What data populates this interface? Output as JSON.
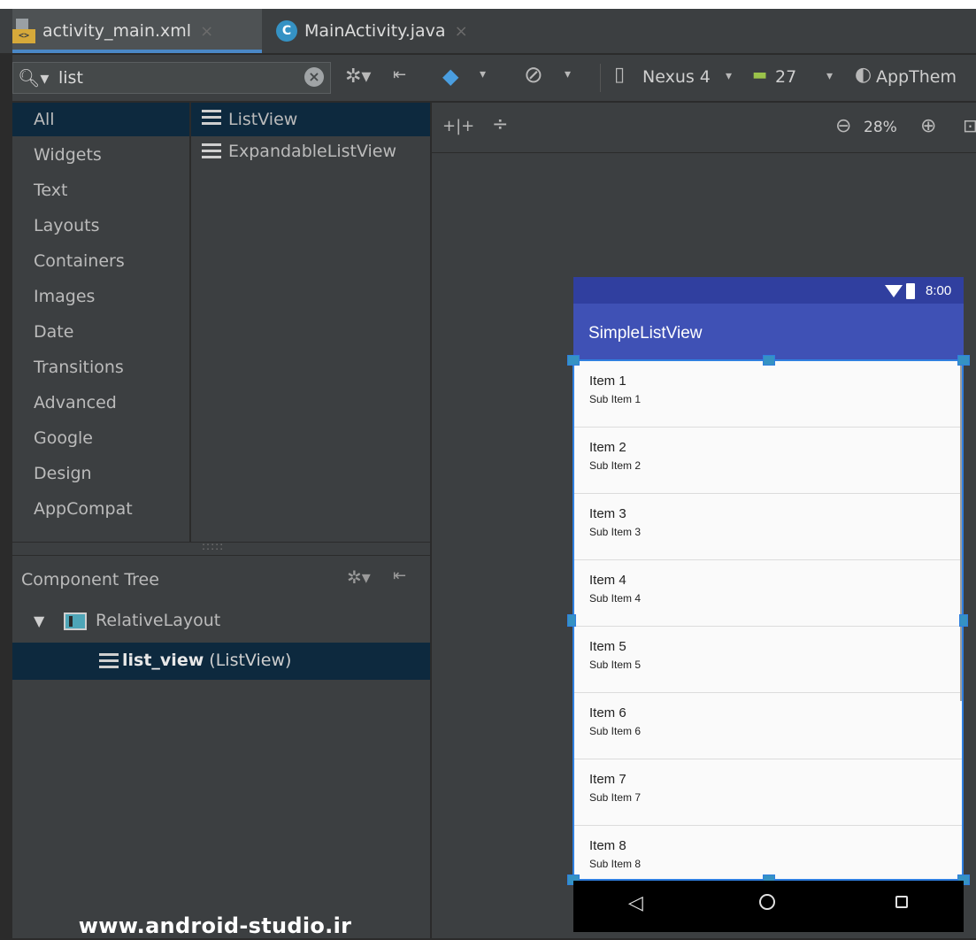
{
  "tabs": [
    {
      "label": "activity_main.xml",
      "icon": "xml-file-icon"
    },
    {
      "label": "MainActivity.java",
      "icon": "java-class-icon"
    }
  ],
  "toolbar": {
    "search_value": "list",
    "xml_badge": "<>",
    "class_badge": "C",
    "device": "Nexus 4",
    "api_level": "27",
    "theme": "AppThem",
    "zoom": "28%",
    "zoom_value": 28
  },
  "palette": {
    "categories": [
      "All",
      "Widgets",
      "Text",
      "Layouts",
      "Containers",
      "Images",
      "Date",
      "Transitions",
      "Advanced",
      "Google",
      "Design",
      "AppCompat"
    ],
    "selected_category": "All",
    "components": [
      "ListView",
      "ExpandableListView"
    ],
    "selected_component": "ListView"
  },
  "component_tree": {
    "title": "Component Tree",
    "root": "RelativeLayout",
    "child_id": "list_view",
    "child_type": " (ListView)"
  },
  "device_preview": {
    "status_time": "8:00",
    "app_title": "SimpleListView",
    "items": [
      {
        "title": "Item 1",
        "subtitle": "Sub Item 1"
      },
      {
        "title": "Item 2",
        "subtitle": "Sub Item 2"
      },
      {
        "title": "Item 3",
        "subtitle": "Sub Item 3"
      },
      {
        "title": "Item 4",
        "subtitle": "Sub Item 4"
      },
      {
        "title": "Item 5",
        "subtitle": "Sub Item 5"
      },
      {
        "title": "Item 6",
        "subtitle": "Sub Item 6"
      },
      {
        "title": "Item 7",
        "subtitle": "Sub Item 7"
      },
      {
        "title": "Item 8",
        "subtitle": "Sub Item 8"
      }
    ],
    "status_bar_color": "#303f9f",
    "app_bar_color": "#3f51b5"
  },
  "watermark": "www.android-studio.ir",
  "colors": {
    "accent": "#4a88c7",
    "selection": "#0d293e",
    "panel": "#3c3f41"
  }
}
